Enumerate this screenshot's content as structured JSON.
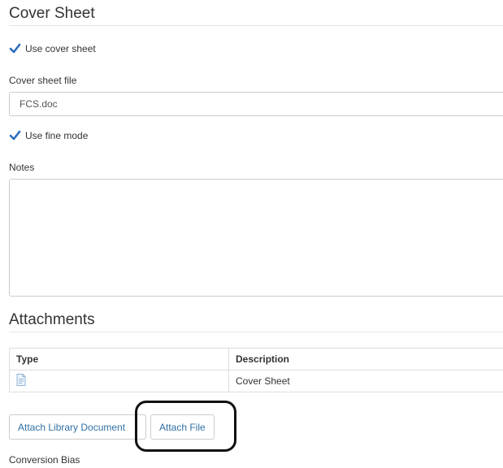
{
  "cover_sheet": {
    "title": "Cover Sheet",
    "use_cover_sheet_label": "Use cover sheet",
    "use_cover_sheet_checked": true,
    "file_label": "Cover sheet file",
    "file_value": "FCS.doc",
    "use_fine_mode_label": "Use fine mode",
    "use_fine_mode_checked": true,
    "notes_label": "Notes",
    "notes_value": ""
  },
  "attachments": {
    "title": "Attachments",
    "columns": [
      "Type",
      "Description"
    ],
    "rows": [
      {
        "type_icon": "document-icon",
        "description": "Cover Sheet"
      }
    ],
    "attach_library_label": "Attach Library Document",
    "attach_file_label": "Attach File"
  },
  "conversion_bias_label": "Conversion Bias",
  "colors": {
    "checkbox": "#2a6ebb",
    "link": "#2f6fa5",
    "highlight": "#111111"
  }
}
